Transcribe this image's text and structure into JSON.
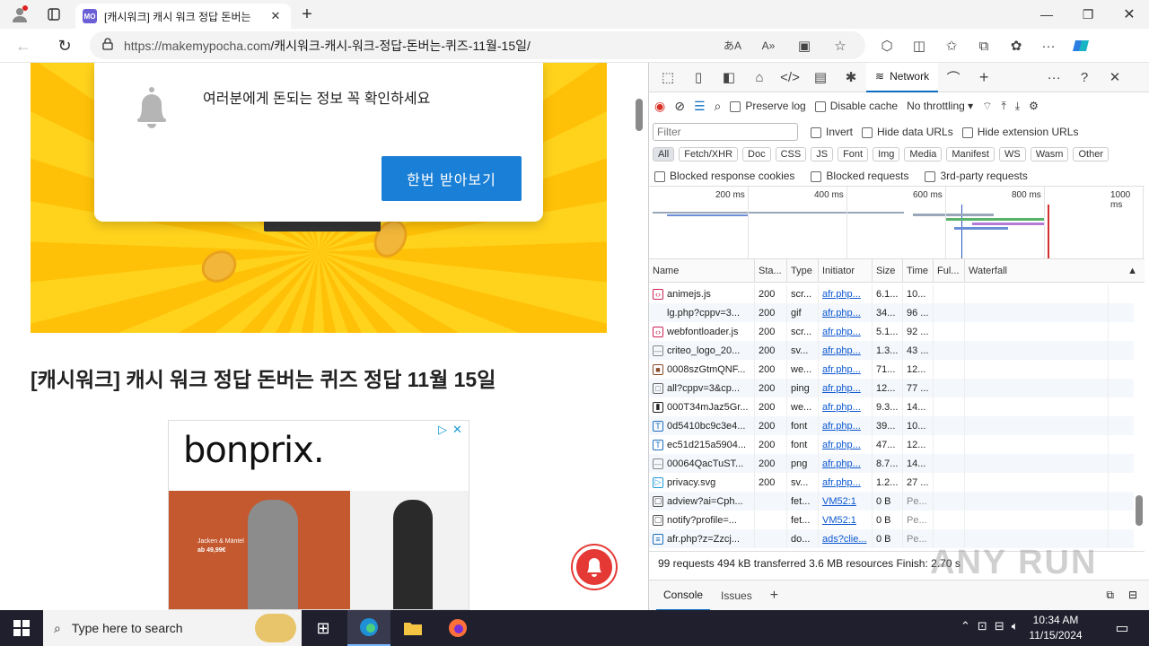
{
  "browser": {
    "tab_title": "[캐시워크] 캐시 워크 정답 돈버는",
    "favicon_text": "MO",
    "url_host": "https://makemypocha.com",
    "url_path": "/캐시워크-캐시-워크-정답-돈버는-퀴즈-11월-15일/"
  },
  "page": {
    "popup_text": "여러분에게 돈되는 정보 꼭 확인하세요",
    "popup_button": "한번 받아보기",
    "article_title": "[캐시워크] 캐시 워크 정답 돈버는 퀴즈 정답 11월 15일",
    "ad_logo": "bonprix.",
    "ad_caption_1": "Jacken & Mäntel",
    "ad_caption_2": "ab 49,99€"
  },
  "devtools": {
    "active_tab": "Network",
    "toolbar": {
      "preserve_log": "Preserve log",
      "disable_cache": "Disable cache",
      "throttling": "No throttling"
    },
    "filter": {
      "placeholder": "Filter",
      "invert": "Invert",
      "hide_data_urls": "Hide data URLs",
      "hide_extension_urls": "Hide extension URLs"
    },
    "type_chips": [
      "All",
      "Fetch/XHR",
      "Doc",
      "CSS",
      "JS",
      "Font",
      "Img",
      "Media",
      "Manifest",
      "WS",
      "Wasm",
      "Other"
    ],
    "options": {
      "blocked_cookies": "Blocked response cookies",
      "blocked_requests": "Blocked requests",
      "third_party": "3rd-party requests"
    },
    "timeline_ticks": [
      "200 ms",
      "400 ms",
      "600 ms",
      "800 ms",
      "1000 ms"
    ],
    "columns": [
      "Name",
      "Sta...",
      "Type",
      "Initiator",
      "Size",
      "Time",
      "Ful...",
      "Waterfall"
    ],
    "rows": [
      {
        "name": "animejs.js",
        "status": "200",
        "type": "scr...",
        "initiator": "afr.php...",
        "size": "6.1...",
        "time": "10...",
        "icon": "code",
        "wf": 0.95
      },
      {
        "name": "lg.php?cppv=3...",
        "status": "200",
        "type": "gif",
        "initiator": "afr.php...",
        "size": "34...",
        "time": "96 ...",
        "icon": "none",
        "wf": 0.96
      },
      {
        "name": "webfontloader.js",
        "status": "200",
        "type": "scr...",
        "initiator": "afr.php...",
        "size": "5.1...",
        "time": "92 ...",
        "icon": "code",
        "wf": 0.96
      },
      {
        "name": "criteo_logo_20...",
        "status": "200",
        "type": "sv...",
        "initiator": "afr.php...",
        "size": "1.3...",
        "time": "43 ...",
        "icon": "dash",
        "wf": 0.97
      },
      {
        "name": "0008szGtmQNF...",
        "status": "200",
        "type": "we...",
        "initiator": "afr.php...",
        "size": "71...",
        "time": "12...",
        "icon": "img",
        "wf": 0.98
      },
      {
        "name": "all?cppv=3&cp...",
        "status": "200",
        "type": "ping",
        "initiator": "afr.php...",
        "size": "12...",
        "time": "77 ...",
        "icon": "box",
        "wf": 0.99
      },
      {
        "name": "000T34mJaz5Gr...",
        "status": "200",
        "type": "we...",
        "initiator": "afr.php...",
        "size": "9.3...",
        "time": "14...",
        "icon": "img2",
        "wf": 0.98
      },
      {
        "name": "0d5410bc9c3e4...",
        "status": "200",
        "type": "font",
        "initiator": "afr.php...",
        "size": "39...",
        "time": "10...",
        "icon": "font",
        "wf": 0.97
      },
      {
        "name": "ec51d215a5904...",
        "status": "200",
        "type": "font",
        "initiator": "afr.php...",
        "size": "47...",
        "time": "12...",
        "icon": "font",
        "wf": 0.98
      },
      {
        "name": "00064QacTuST...",
        "status": "200",
        "type": "png",
        "initiator": "afr.php...",
        "size": "8.7...",
        "time": "14...",
        "icon": "dash",
        "wf": 0.98
      },
      {
        "name": "privacy.svg",
        "status": "200",
        "type": "sv...",
        "initiator": "afr.php...",
        "size": "1.2...",
        "time": "27 ...",
        "icon": "play",
        "wf": 0.97
      },
      {
        "name": "adview?ai=Cph...",
        "status": "",
        "type": "fet...",
        "initiator": "VM52:1",
        "size": "0 B",
        "time": "Pe...",
        "icon": "doc",
        "wf": null
      },
      {
        "name": "notify?profile=...",
        "status": "",
        "type": "fet...",
        "initiator": "VM52:1",
        "size": "0 B",
        "time": "Pe...",
        "icon": "doc",
        "wf": null
      },
      {
        "name": "afr.php?z=Zzcj...",
        "status": "",
        "type": "do...",
        "initiator": "ads?clie...",
        "size": "0 B",
        "time": "Pe...",
        "icon": "doc2",
        "wf": null
      }
    ],
    "summary": "99 requests  494 kB transferred  3.6 MB resources  Finish: 2.70 s",
    "drawer_tabs": [
      "Console",
      "Issues"
    ]
  },
  "taskbar": {
    "search_placeholder": "Type here to search",
    "time": "10:34 AM",
    "date": "11/15/2024"
  },
  "watermark": "ANY RUN"
}
